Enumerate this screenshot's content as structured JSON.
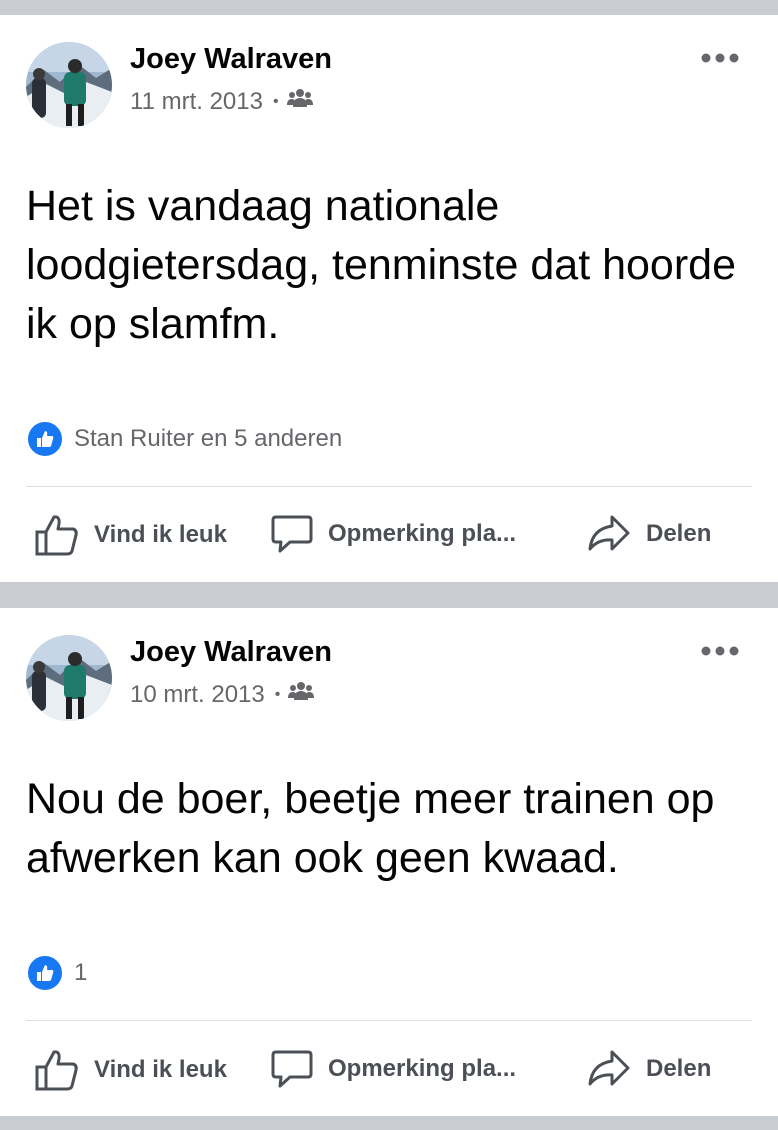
{
  "posts": [
    {
      "author": "Joey Walraven",
      "date": "11 mrt. 2013",
      "audience_icon": "friends-icon",
      "text": "Het is vandaag nationale loodgietersdag, tenminste dat hoorde ik op slamfm.",
      "reactions": "Stan Ruiter en 5 anderen",
      "actions": {
        "like": "Vind ik leuk",
        "comment": "Opmerking pla...",
        "share": "Delen"
      }
    },
    {
      "author": "Joey Walraven",
      "date": "10 mrt. 2013",
      "audience_icon": "friends-icon",
      "text": "Nou de boer, beetje meer trainen op afwerken kan ook geen kwaad.",
      "reactions": "1",
      "actions": {
        "like": "Vind ik leuk",
        "comment": "Opmerking pla...",
        "share": "Delen"
      }
    }
  ],
  "colors": {
    "like_blue": "#1877f2",
    "meta_gray": "#65676b",
    "separator": "#c9ccd1"
  }
}
